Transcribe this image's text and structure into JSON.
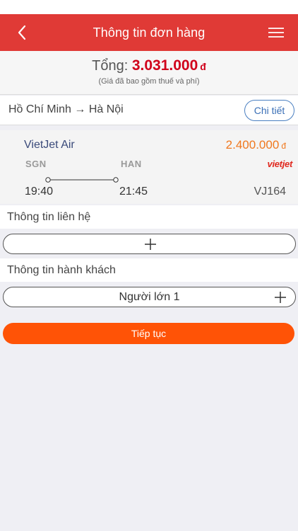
{
  "header": {
    "title": "Thông tin đơn hàng",
    "back_icon": "chevron-left-icon",
    "menu_icon": "hamburger-menu-icon",
    "color": "#e03a36"
  },
  "summary": {
    "total_label": "Tổng:",
    "total_amount": "3.031.000",
    "currency": "đ",
    "note": "(Giá đã bao gồm thuế và phí)",
    "amount_color": "#d0021b"
  },
  "route": {
    "text": "Hồ Chí Minh → Hà Nội",
    "detail_label": "Chi tiết"
  },
  "flight": {
    "airline": "VietJet Air",
    "price": "2.400.000",
    "currency": "đ",
    "from_code": "SGN",
    "to_code": "HAN",
    "logo_text": "vietjet",
    "departure_time": "19:40",
    "arrival_time": "21:45",
    "flight_number": "VJ164",
    "price_color": "#f0781e"
  },
  "contact": {
    "label": "Thông tin liên hệ",
    "add_icon": "plus-icon"
  },
  "passengers": {
    "label": "Thông tin hành khách",
    "items": [
      {
        "label": "Người lớn 1"
      }
    ]
  },
  "actions": {
    "continue_label": "Tiếp tục",
    "continue_color": "#ff5306"
  }
}
